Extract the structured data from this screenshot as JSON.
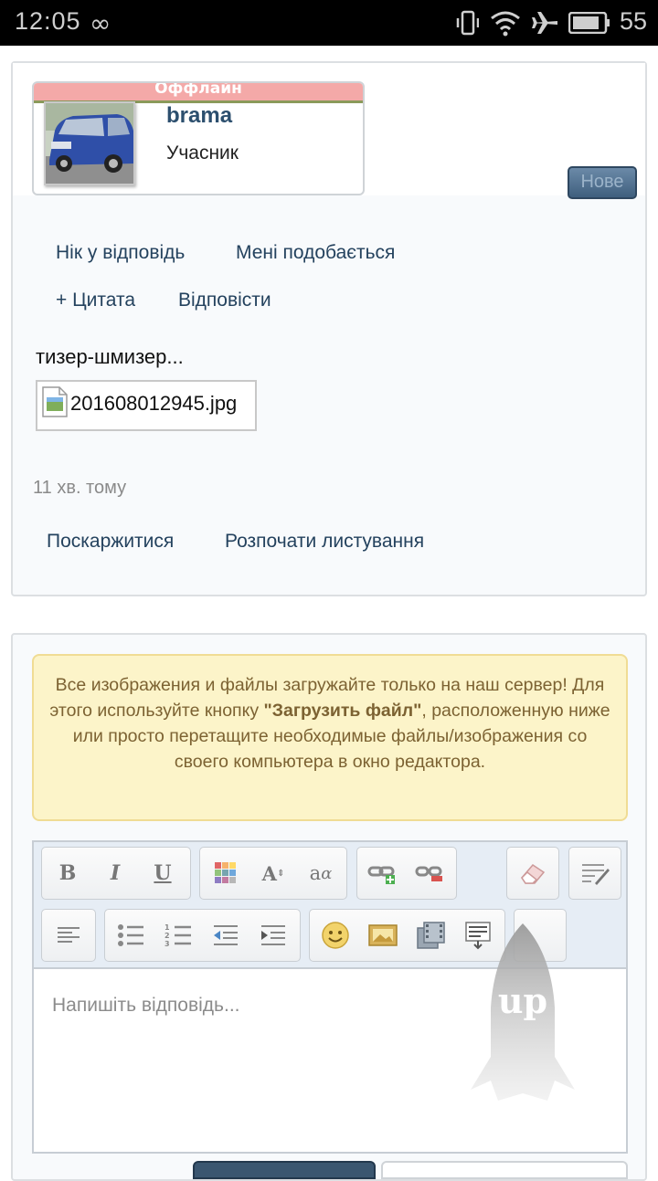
{
  "status_bar": {
    "time": "12:05",
    "battery": "55"
  },
  "post": {
    "status_label": "Оффлайн",
    "username": "brama",
    "role": "Учасник",
    "new_badge": "Нове",
    "actions": [
      "Нік у відповідь",
      "Мені подобається",
      "+ Цитата",
      "Відповісти"
    ],
    "message": "тизер-шмизер...",
    "attachment": "201608012945.jpg",
    "time_ago": "11 хв. тому",
    "footer_actions": [
      "Поскаржитися",
      "Розпочати листування"
    ]
  },
  "reply": {
    "notice_before": "Все изображения и файлы загружайте только на наш сервер! Для этого используйте кнопку ",
    "notice_bold": "\"Загрузить файл\"",
    "notice_after": ", расположенную ниже или просто перетащите необходимые файлы/изображения со своего компьютера в окно редактора.",
    "placeholder": "Напишіть відповідь...",
    "toolbar_icons": [
      "bold-icon",
      "italic-icon",
      "underline-icon",
      "color-icon",
      "font-size-icon",
      "font-family-icon",
      "link-icon",
      "unlink-icon",
      "eraser-icon",
      "source-icon",
      "align-icon",
      "bullet-list-icon",
      "numbered-list-icon",
      "outdent-icon",
      "indent-icon",
      "smiley-icon",
      "image-icon",
      "media-icon",
      "more-icon"
    ],
    "toolbar_labels": {
      "bold": "B",
      "italic": "I",
      "underline": "U",
      "font_size": "A",
      "font_family": "a"
    },
    "scroll_up_label": "up"
  },
  "colors": {
    "link": "#24425e",
    "offline_bar": "#f4a9a8",
    "notice_bg": "#fcf4c9",
    "notice_text": "#7c6232",
    "button": "#3f5f7e"
  }
}
